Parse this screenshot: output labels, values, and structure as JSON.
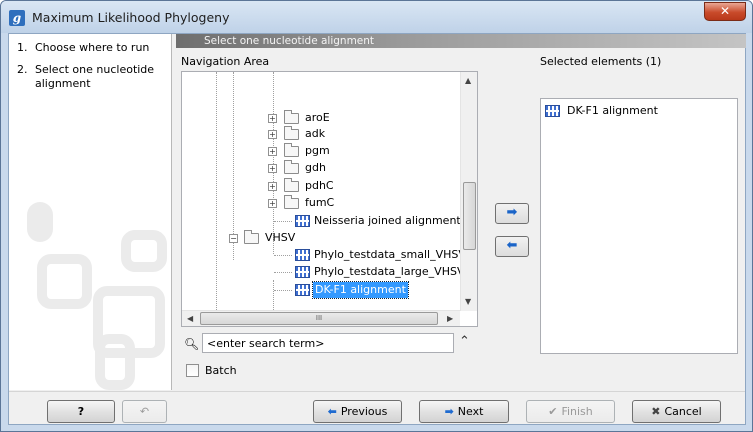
{
  "window": {
    "title": "Maximum Likelihood Phylogeny",
    "app_icon_letter": "g"
  },
  "steps": [
    {
      "num": "1.",
      "label": "Choose where to run"
    },
    {
      "num": "2.",
      "label": "Select one nucleotide alignment"
    }
  ],
  "header": "Select one nucleotide alignment",
  "navigation_label": "Navigation Area",
  "selected_label": "Selected elements (1)",
  "tree": [
    {
      "label": "aroE",
      "type": "folder"
    },
    {
      "label": "adk",
      "type": "folder"
    },
    {
      "label": "pgm",
      "type": "folder"
    },
    {
      "label": "gdh",
      "type": "folder"
    },
    {
      "label": "pdhC",
      "type": "folder"
    },
    {
      "label": "fumC",
      "type": "folder"
    },
    {
      "label": "Neisseria joined alignment",
      "type": "alignment"
    },
    {
      "label": "VHSV",
      "type": "folder-open"
    },
    {
      "label": "Phylo_testdata_small_VHSV al",
      "type": "alignment"
    },
    {
      "label": "Phylo_testdata_large_VHSV al",
      "type": "alignment"
    },
    {
      "label": "DK-F1 alignment",
      "type": "alignment",
      "selected": true
    }
  ],
  "selected_elements": [
    {
      "label": "DK-F1 alignment"
    }
  ],
  "search": {
    "placeholder": "<enter search term>",
    "value": "<enter search term>"
  },
  "batch_label": "Batch",
  "buttons": {
    "help": "?",
    "previous": "Previous",
    "next": "Next",
    "finish": "Finish",
    "cancel": "Cancel"
  }
}
